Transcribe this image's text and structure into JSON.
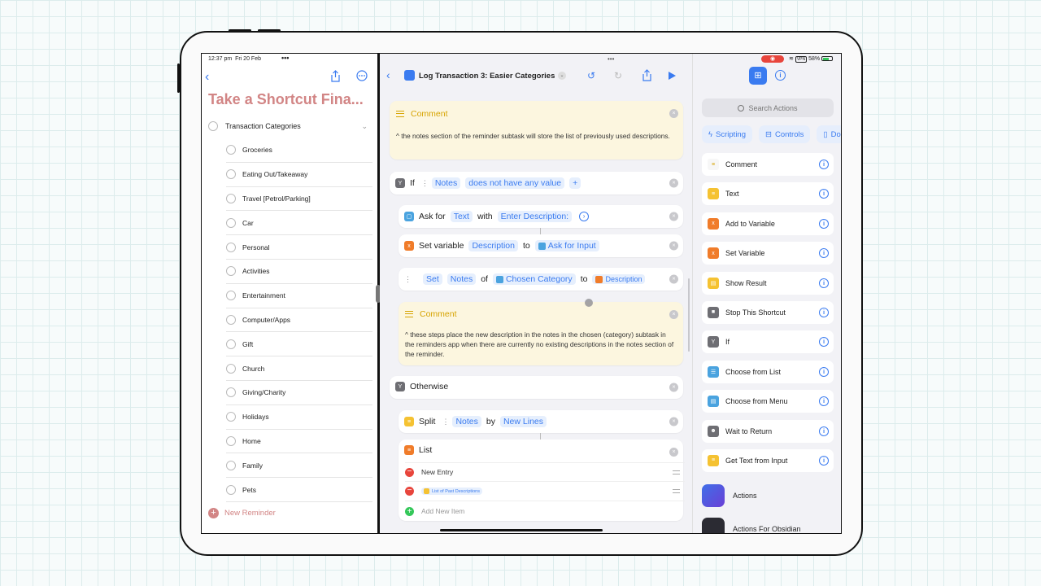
{
  "status_bar": {
    "time": "12:37 pm",
    "date": "Fri 20 Feb",
    "battery": "58%"
  },
  "reminders": {
    "title": "Take a Shortcut Fina...",
    "parent": "Transaction Categories",
    "items": [
      "Groceries",
      "Eating Out/Takeaway",
      "Travel [Petrol/Parking]",
      "Car",
      "Personal",
      "Activities",
      "Entertainment",
      "Computer/Apps",
      "Gift",
      "Church",
      "Giving/Charity",
      "Holidays",
      "Home",
      "Family",
      "Pets"
    ],
    "new_reminder": "New Reminder"
  },
  "editor": {
    "title": "Log Transaction 3: Easier Categories",
    "comment1": {
      "label": "Comment",
      "text": "^ the notes section of the reminder subtask will store the list of previously used descriptions."
    },
    "if_row": {
      "keyword": "If",
      "var": "Notes",
      "cond": "does not have any value"
    },
    "ask_row": {
      "keyword": "Ask for",
      "type": "Text",
      "with": "with",
      "prompt": "Enter Description:"
    },
    "setvar_row": {
      "keyword": "Set variable",
      "var": "Description",
      "to": "to",
      "value": "Ask for Input"
    },
    "set_row": {
      "keyword": "Set",
      "prop": "Notes",
      "of": "of",
      "target": "Chosen Category",
      "to": "to",
      "value": "Description"
    },
    "comment2": {
      "label": "Comment",
      "text": "^ these steps place the new description in the notes in the chosen (category) subtask in the reminders app when there are currently no existing descriptions in the notes section of the reminder."
    },
    "otherwise": "Otherwise",
    "split_row": {
      "keyword": "Split",
      "var": "Notes",
      "by": "by",
      "sep": "New Lines"
    },
    "list": {
      "label": "List",
      "entries": [
        "New Entry",
        "List of Past Descriptions"
      ],
      "add": "Add New Item"
    }
  },
  "actions": {
    "search_placeholder": "Search Actions",
    "chips": [
      "Scripting",
      "Controls",
      "Do"
    ],
    "items": [
      {
        "label": "Comment",
        "color": "#f7f7f7",
        "icon": "comment-icon"
      },
      {
        "label": "Text",
        "color": "#f5c232",
        "icon": "text-icon"
      },
      {
        "label": "Add to Variable",
        "color": "#f07c2a",
        "icon": "variable-icon"
      },
      {
        "label": "Set Variable",
        "color": "#f07c2a",
        "icon": "variable-icon"
      },
      {
        "label": "Show Result",
        "color": "#f5c232",
        "icon": "result-icon"
      },
      {
        "label": "Stop This Shortcut",
        "color": "#6e6e73",
        "icon": "stop-icon"
      },
      {
        "label": "If",
        "color": "#6e6e73",
        "icon": "branch-icon"
      },
      {
        "label": "Choose from List",
        "color": "#4aa3df",
        "icon": "list-icon"
      },
      {
        "label": "Choose from Menu",
        "color": "#4aa3df",
        "icon": "menu-icon"
      },
      {
        "label": "Wait to Return",
        "color": "#6e6e73",
        "icon": "person-icon"
      },
      {
        "label": "Get Text from Input",
        "color": "#f5c232",
        "icon": "text-icon"
      }
    ],
    "apps": [
      "Actions",
      "Actions For Obsidian"
    ]
  }
}
